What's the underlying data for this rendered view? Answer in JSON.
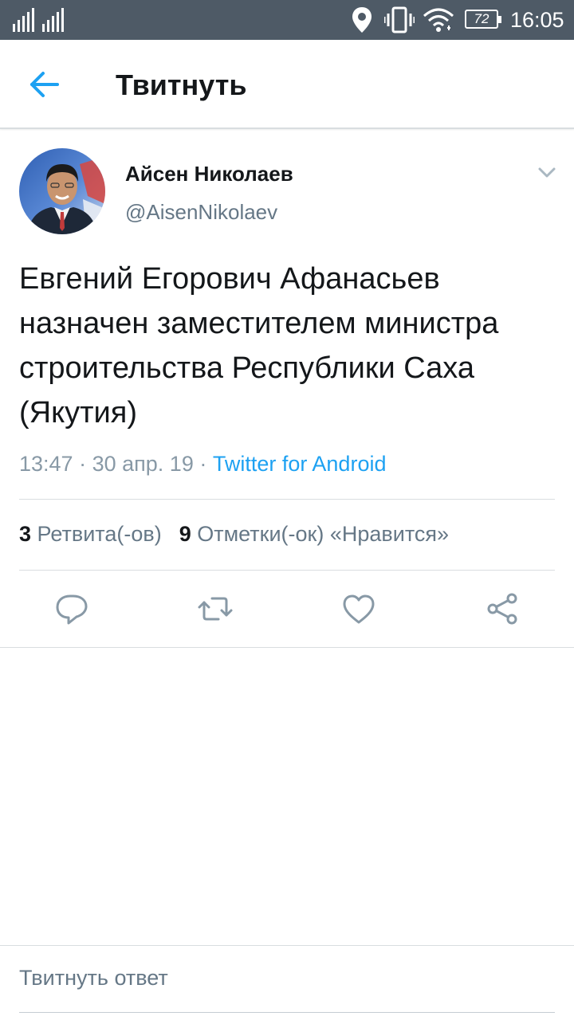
{
  "status_bar": {
    "time": "16:05",
    "battery": "72",
    "icons": [
      "signal-icon",
      "signal-icon",
      "location-icon",
      "vibrate-icon",
      "wifi-icon",
      "battery-icon"
    ]
  },
  "toolbar": {
    "title": "Твитнуть",
    "back_icon": "arrow-left-icon"
  },
  "tweet": {
    "author_name": "Айсен Николаев",
    "author_handle": "@AisenNikolaev",
    "text": "Евгений Егорович Афанасьев назначен заместителем министра строительства Республики Саха (Якутия)",
    "time": "13:47",
    "date": "30 апр. 19",
    "separator": "·",
    "source": "Twitter for Android",
    "retweets_count": "3",
    "retweets_label": "Ретвита(-ов)",
    "likes_count": "9",
    "likes_label": "Отметки(-ок) «Нравится»"
  },
  "actions": [
    "reply-icon",
    "retweet-icon",
    "like-icon",
    "share-icon"
  ],
  "reply_bar": {
    "placeholder": "Твитнуть ответ"
  },
  "colors": {
    "status_bar": "#4e5a66",
    "accent": "#1da1f2",
    "secondary_text": "#657786",
    "icon_gray": "#8899a6"
  }
}
